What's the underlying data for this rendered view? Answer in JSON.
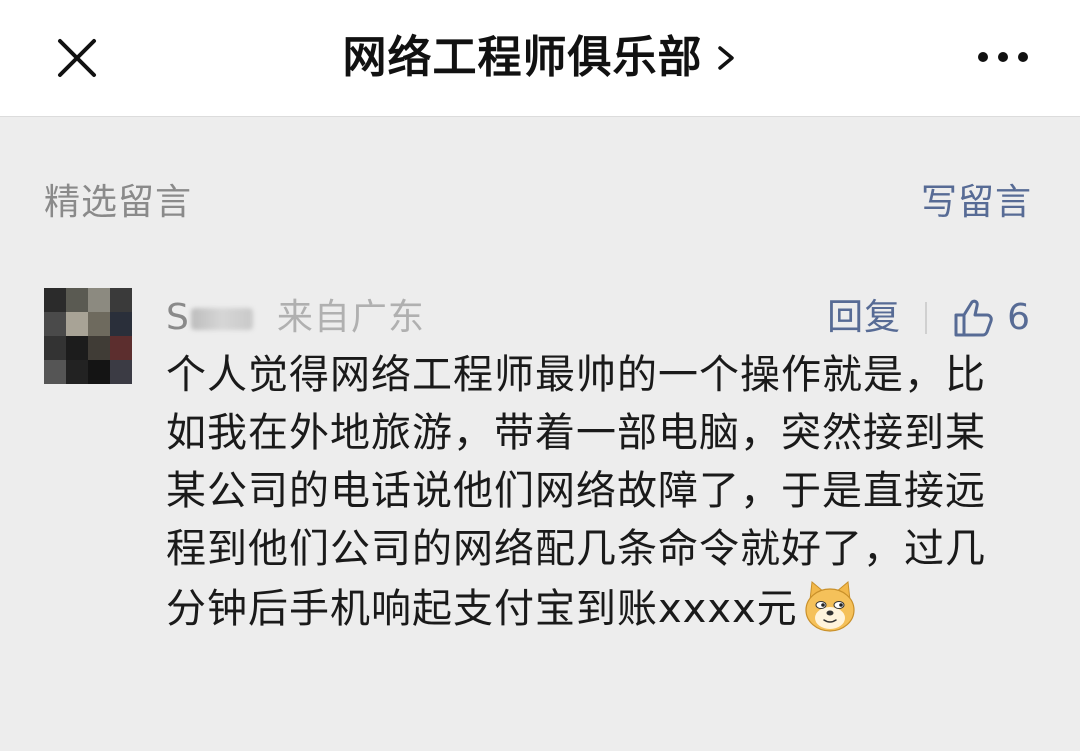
{
  "header": {
    "title": "网络工程师俱乐部",
    "close_icon": "close-icon",
    "more_icon": "more-icon",
    "chevron_icon": "chevron-right-icon"
  },
  "comments_section": {
    "title": "精选留言",
    "write_label": "写留言"
  },
  "comment": {
    "nickname_visible": "S",
    "location": "来自广东",
    "reply_label": "回复",
    "like_count": "6",
    "text": "个人觉得网络工程师最帅的一个操作就是，比如我在外地旅游，带着一部电脑，突然接到某某公司的电话说他们网络故障了，于是直接远程到他们公司的网络配几条命令就好了，过几分钟后手机响起支付宝到账xxxx元",
    "emoji": "doge-emoji-icon"
  },
  "colors": {
    "background": "#ededed",
    "link": "#576b95",
    "muted": "#8a8a8a",
    "text": "#1a1a1a"
  }
}
